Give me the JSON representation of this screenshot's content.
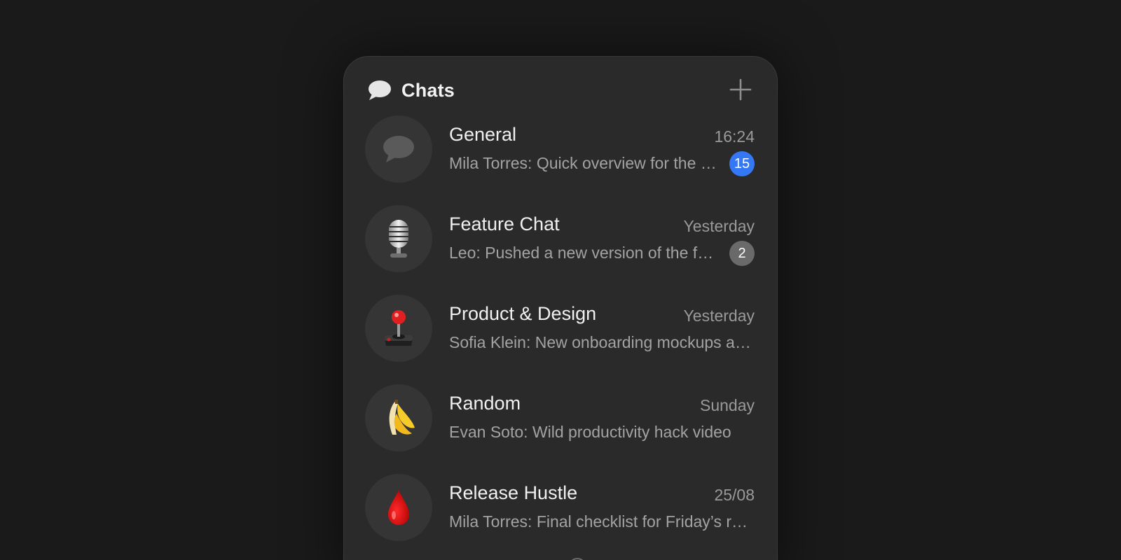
{
  "header": {
    "title": "Chats",
    "icon": "speech-bubble-icon",
    "add_icon": "plus-icon"
  },
  "chats": [
    {
      "name": "General",
      "time": "16:24",
      "preview": "Mila Torres: Quick overview for the team",
      "badge": "15",
      "badge_color": "#3478f6",
      "avatar_icon": "speech-bubble-icon"
    },
    {
      "name": "Feature Chat",
      "time": "Yesterday",
      "preview": "Leo: Pushed a new version of the feature",
      "badge": "2",
      "badge_color": "#6a6a6a",
      "avatar_icon": "microphone-icon"
    },
    {
      "name": "Product & Design",
      "time": "Yesterday",
      "preview": "Sofia Klein: New onboarding mockups are ready",
      "avatar_icon": "joystick-icon"
    },
    {
      "name": "Random",
      "time": "Sunday",
      "preview": "Evan Soto: Wild productivity hack video",
      "avatar_icon": "banana-icon"
    },
    {
      "name": "Release Hustle",
      "time": "25/08",
      "preview": "Mila Torres: Final checklist for Friday’s release",
      "avatar_icon": "blood-drop-icon"
    }
  ],
  "colors": {
    "background": "#1a1a1a",
    "panel": "#2a2a2a",
    "accent": "#3478f6",
    "muted_badge": "#6a6a6a"
  }
}
